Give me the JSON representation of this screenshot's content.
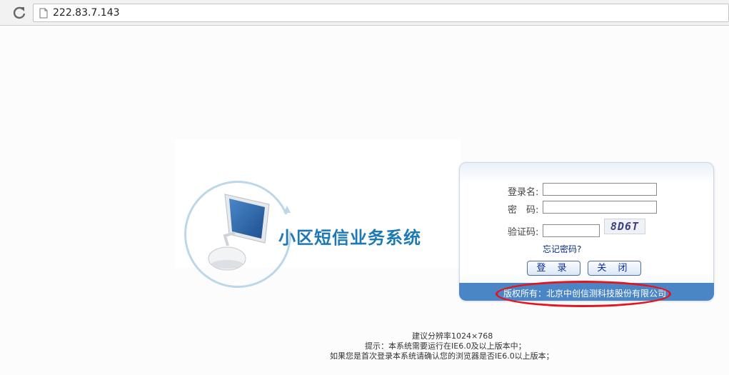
{
  "browser": {
    "url": "222.83.7.143",
    "back_glyph": "‹"
  },
  "app": {
    "system_title": "小区短信业务系统"
  },
  "login": {
    "username_label": "登录名:",
    "username_value": "",
    "password_label": "密　码:",
    "password_value": "",
    "captcha_label": "验证码:",
    "captcha_value": "",
    "captcha_image_text": "8D6T",
    "forgot_password": "忘记密码?",
    "login_button": "登 录",
    "close_button": "关 闭",
    "copyright": "版权所有：北京中创信测科技股份有限公司"
  },
  "notes": {
    "resolution": "建议分辨率1024×768",
    "tip": "提示：本系统需要运行在IE6.0及以上版本中；",
    "first_login": "如果您是首次登录本系统请确认您的浏览器是否IE6.0以上版本；"
  },
  "colors": {
    "title_blue": "#1c79b6",
    "band_blue": "#4a86c5",
    "annotation_red": "#e8121b"
  }
}
